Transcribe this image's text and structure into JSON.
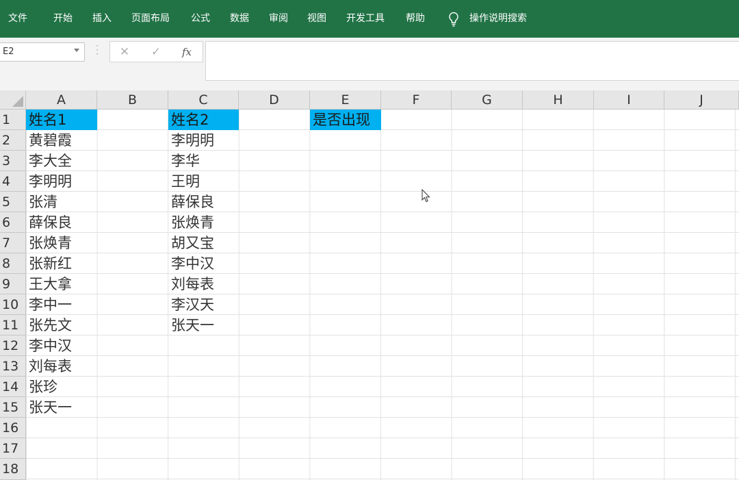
{
  "menu": [
    "文件",
    "开始",
    "插入",
    "页面布局",
    "公式",
    "数据",
    "审阅",
    "视图",
    "开发工具",
    "帮助"
  ],
  "search_label": "操作说明搜索",
  "name_box": "E2",
  "formula_buttons": {
    "cancel": "✕",
    "confirm": "✓",
    "fx": "fx"
  },
  "formula_value": "",
  "columns": [
    "A",
    "B",
    "C",
    "D",
    "E",
    "F",
    "G",
    "H",
    "I",
    "J"
  ],
  "rows": [
    "1",
    "2",
    "3",
    "4",
    "5",
    "6",
    "7",
    "8",
    "9",
    "10",
    "11",
    "12",
    "13",
    "14",
    "15",
    "16",
    "17",
    "18"
  ],
  "colA": [
    "姓名1",
    "黄碧霞",
    "李大全",
    "李明明",
    "张清",
    "薛保良",
    "张焕青",
    "张新红",
    "王大拿",
    "李中一",
    "张先文",
    "李中汉",
    "刘每表",
    "张珍",
    "张天一"
  ],
  "colC": [
    "姓名2",
    "李明明",
    "李华",
    "王明",
    "薛保良",
    "张焕青",
    "胡又宝",
    "李中汉",
    "刘每表",
    "李汉天",
    "张天一"
  ],
  "colE": [
    "是否出现"
  ],
  "colors": {
    "ribbon": "#217346",
    "header_fill": "#00b0f0"
  }
}
